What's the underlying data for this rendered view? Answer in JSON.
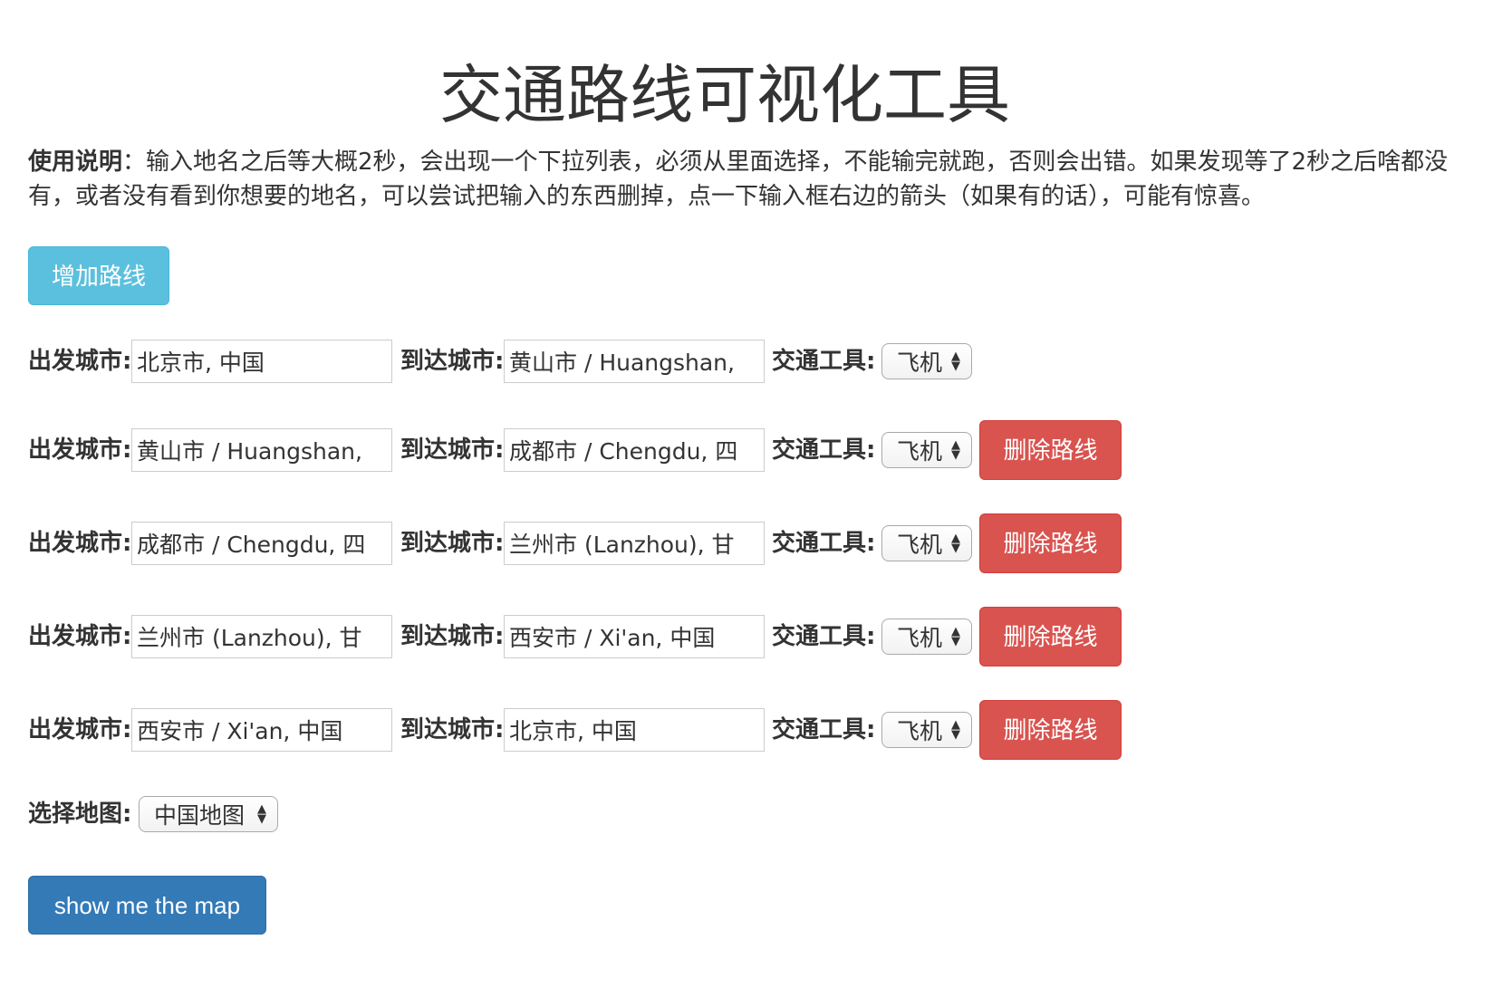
{
  "title": "交通路线可视化工具",
  "instructions": {
    "lead": "使用说明",
    "text": "：输入地名之后等大概2秒，会出现一个下拉列表，必须从里面选择，不能输完就跑，否则会出错。如果发现等了2秒之后啥都没有，或者没有看到你想要的地名，可以尝试把输入的东西删掉，点一下输入框右边的箭头（如果有的话），可能有惊喜。"
  },
  "add_route_label": "增加路线",
  "labels": {
    "from": "出发城市:",
    "to": "到达城市:",
    "transport": "交通工具:"
  },
  "routes": [
    {
      "from": "北京市, 中国",
      "to": "黄山市 / Huangshan, ",
      "transport": "飞机",
      "delete_label": ""
    },
    {
      "from": "黄山市 / Huangshan, ",
      "to": "成都市 / Chengdu, 四",
      "transport": "飞机",
      "delete_label": "删除路线"
    },
    {
      "from": "成都市 / Chengdu, 四",
      "to": "兰州市 (Lanzhou), 甘",
      "transport": "飞机",
      "delete_label": "删除路线"
    },
    {
      "from": "兰州市 (Lanzhou), 甘",
      "to": "西安市 / Xi'an, 中国",
      "transport": "飞机",
      "delete_label": "删除路线"
    },
    {
      "from": "西安市 / Xi'an, 中国",
      "to": "北京市, 中国",
      "transport": "飞机",
      "delete_label": "删除路线"
    }
  ],
  "map_select": {
    "label": "选择地图:",
    "value": "中国地图"
  },
  "show_map_label": "show me the map",
  "colors": {
    "info": "#5bc0de",
    "danger": "#d9534f",
    "primary": "#337ab7",
    "text": "#333333"
  }
}
